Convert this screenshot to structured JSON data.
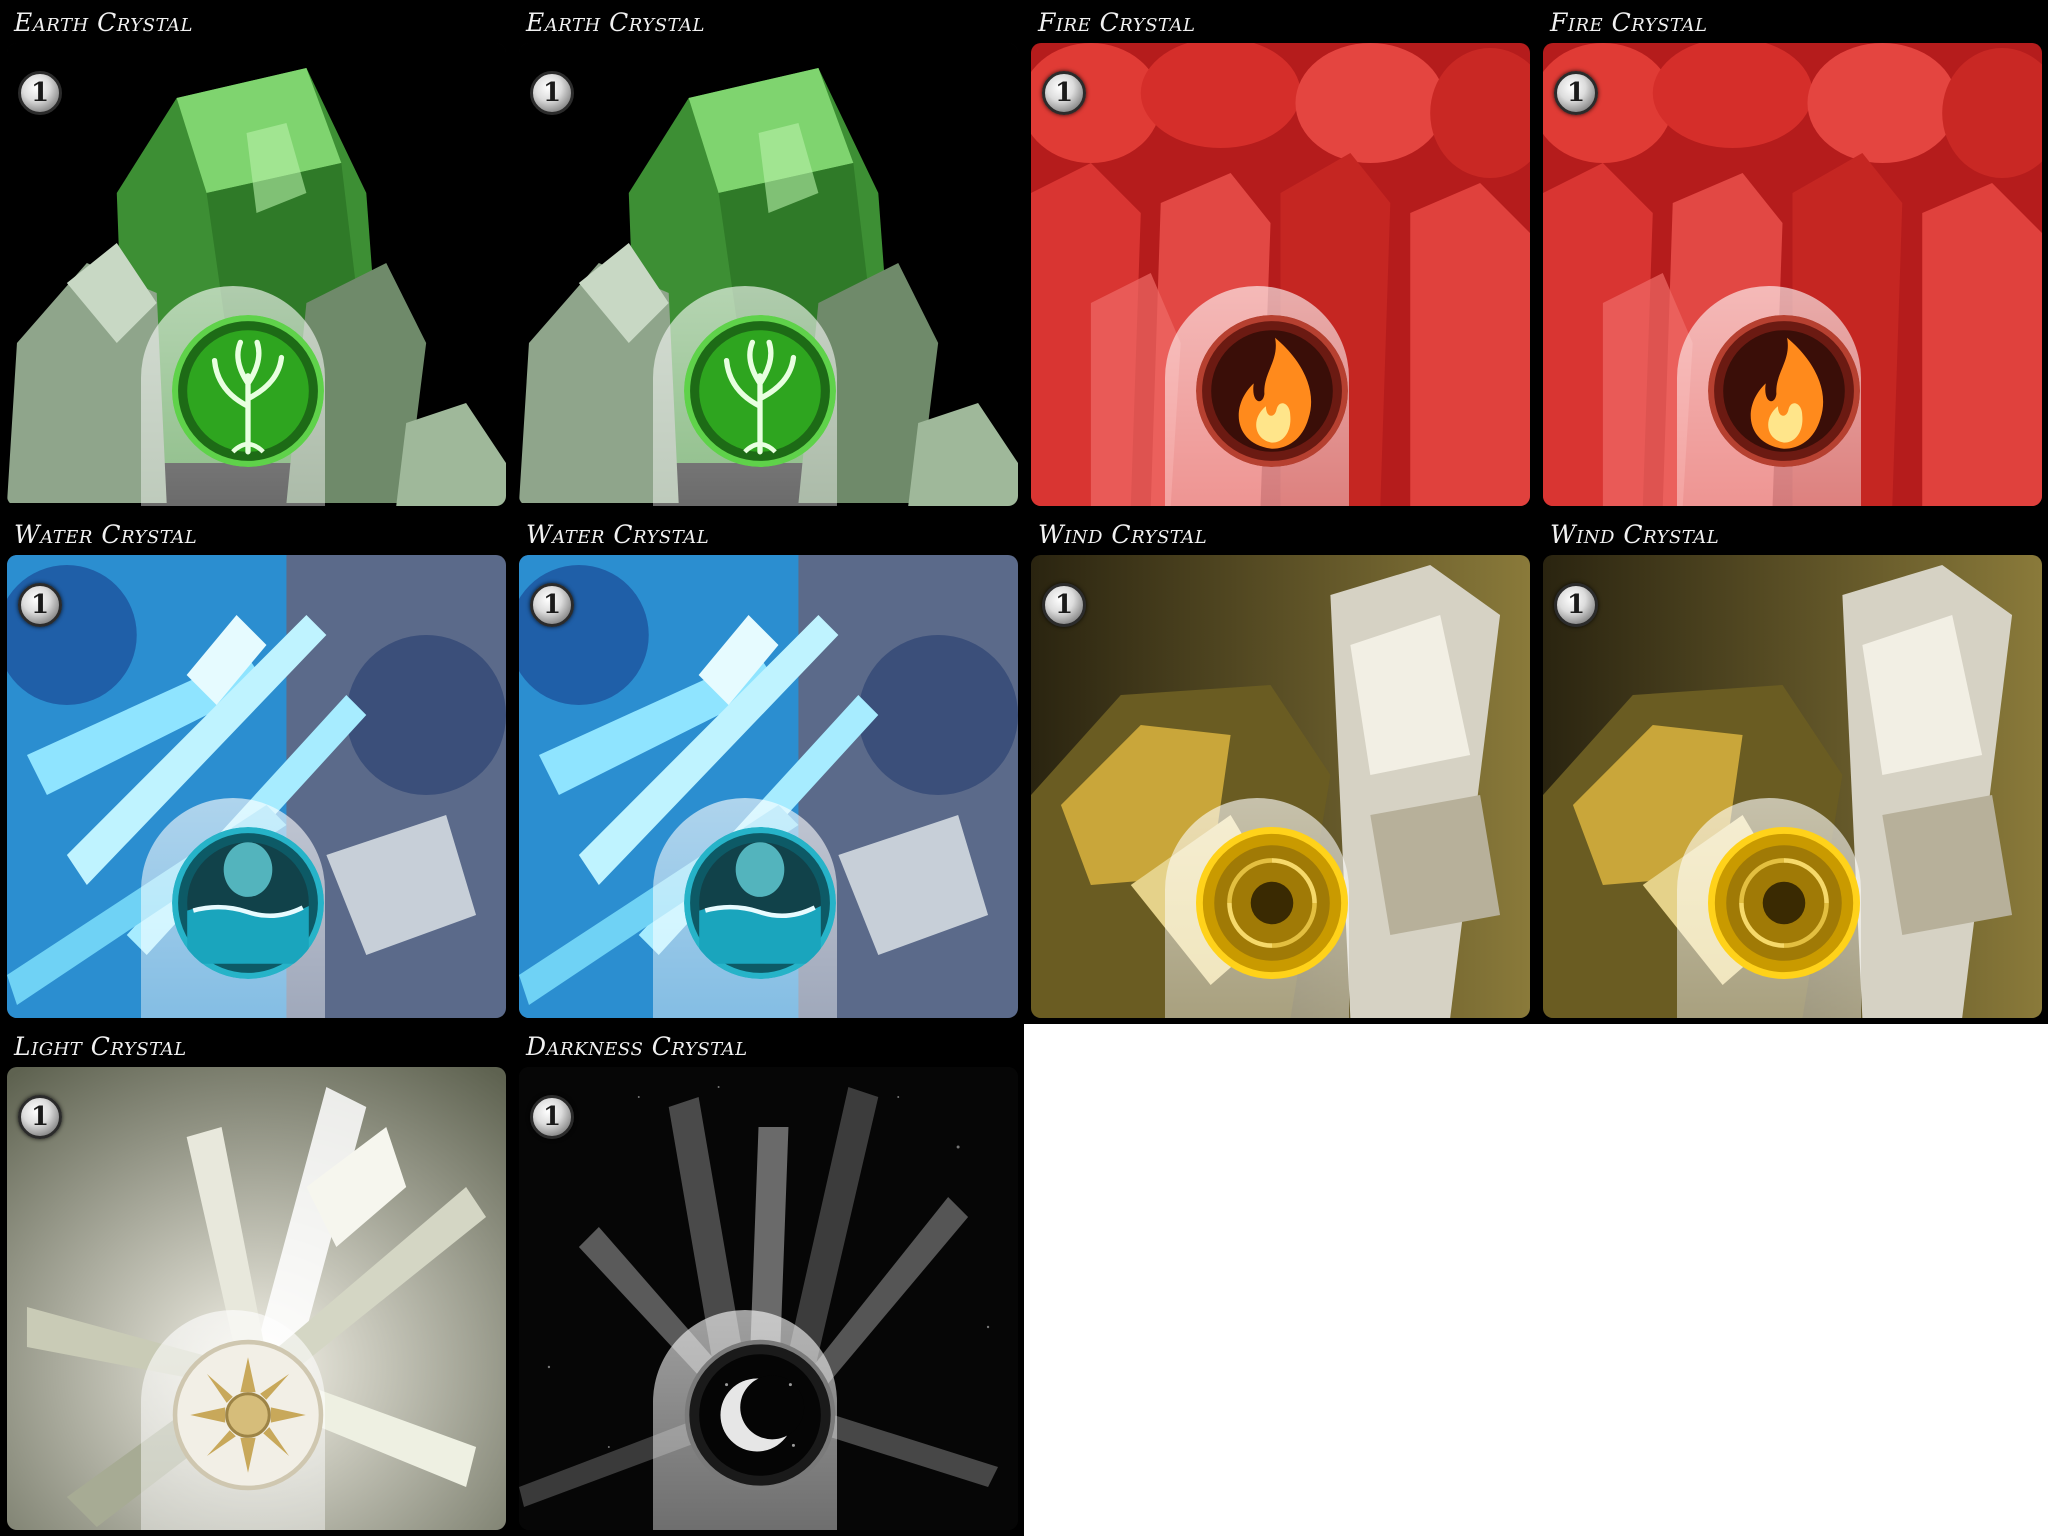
{
  "cards": [
    {
      "title": "Earth Crystal",
      "cost": "1",
      "element": "earth",
      "emblem_icon": "tree-icon",
      "accent": "#45d23a"
    },
    {
      "title": "Earth Crystal",
      "cost": "1",
      "element": "earth",
      "emblem_icon": "tree-icon",
      "accent": "#45d23a"
    },
    {
      "title": "Fire Crystal",
      "cost": "1",
      "element": "fire",
      "emblem_icon": "flame-icon",
      "accent": "#d9342e"
    },
    {
      "title": "Fire Crystal",
      "cost": "1",
      "element": "fire",
      "emblem_icon": "flame-icon",
      "accent": "#d9342e"
    },
    {
      "title": "Water Crystal",
      "cost": "1",
      "element": "water",
      "emblem_icon": "wave-icon",
      "accent": "#2fb4d6"
    },
    {
      "title": "Water Crystal",
      "cost": "1",
      "element": "water",
      "emblem_icon": "wave-icon",
      "accent": "#2fb4d6"
    },
    {
      "title": "Wind Crystal",
      "cost": "1",
      "element": "wind",
      "emblem_icon": "vortex-icon",
      "accent": "#e0b40a"
    },
    {
      "title": "Wind Crystal",
      "cost": "1",
      "element": "wind",
      "emblem_icon": "vortex-icon",
      "accent": "#e0b40a"
    },
    {
      "title": "Light Crystal",
      "cost": "1",
      "element": "light",
      "emblem_icon": "sun-icon",
      "accent": "#e6dcc0"
    },
    {
      "title": "Darkness Crystal",
      "cost": "1",
      "element": "darkness",
      "emblem_icon": "crescent-moon-icon",
      "accent": "#6a6a6a"
    }
  ]
}
